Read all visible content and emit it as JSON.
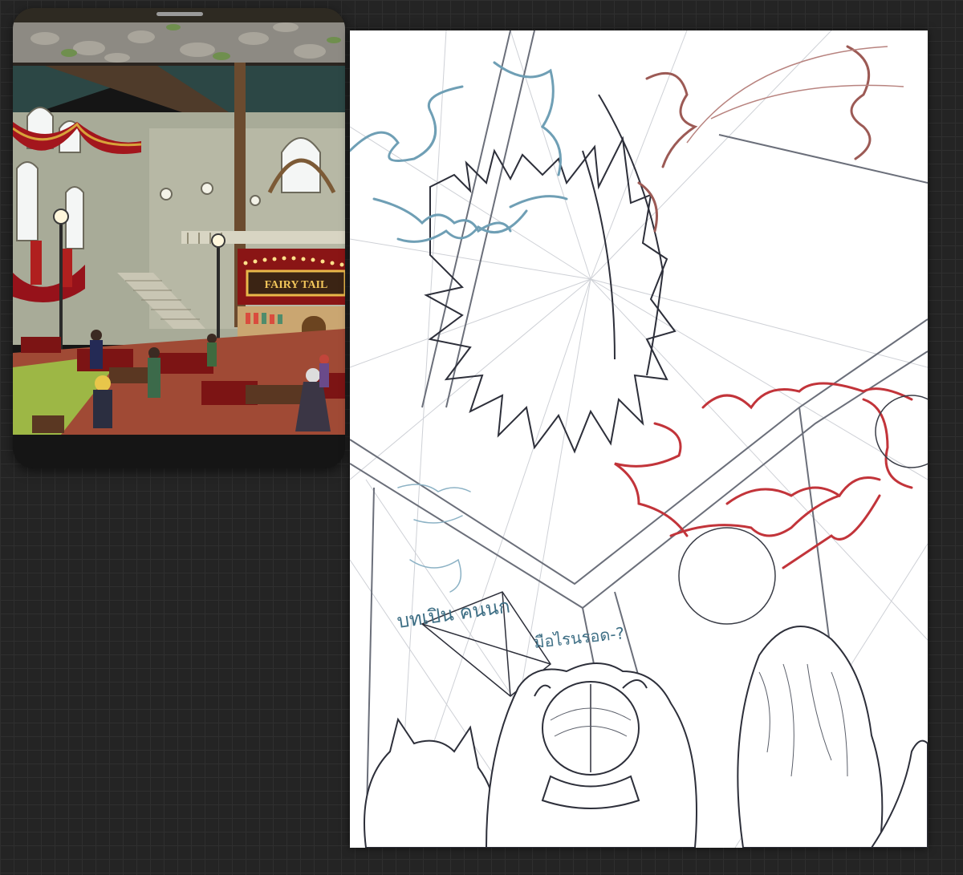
{
  "app": {
    "title": "",
    "colors": {
      "workspace_bg": "#242424",
      "grid_line": "#2f2f2f",
      "panel_bg": "#151515",
      "canvas_bg": "#ffffff",
      "sketch_blue": "#6f9fb5",
      "sketch_red": "#c2343a",
      "sketch_brown": "#9c5a55",
      "sketch_lines": "#2d2f3a"
    }
  },
  "reference_panel": {
    "sign_text": "FAIRY TAIL",
    "handle_icon": "drag-handle-icon"
  },
  "canvas": {
    "handwritten_note_line1": "บทเปิน คนนก",
    "handwritten_note_line2": "มือไรนรอด-?"
  }
}
